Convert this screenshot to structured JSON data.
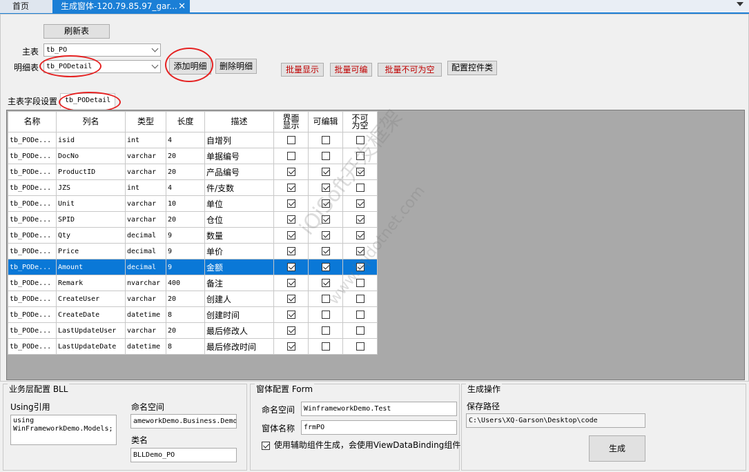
{
  "tabs": {
    "home": "首页",
    "active": "生成窗体-120.79.85.97_gar...",
    "close": "✕"
  },
  "toolbar": {
    "refresh": "刷新表",
    "main_table_label": "主表",
    "main_table_value": "tb_PO",
    "detail_table_label": "明细表",
    "detail_table_value": "tb_PODetail",
    "add_detail": "添加明细",
    "delete_detail": "删除明细",
    "batch_show": "批量显示",
    "batch_edit": "批量可编",
    "batch_required": "批量不可为空",
    "config_control": "配置控件类"
  },
  "subtabs": {
    "main": "主表字段设置",
    "detail": "tb_PODetail"
  },
  "grid": {
    "headers": {
      "name": "名称",
      "column": "列名",
      "type": "类型",
      "length": "长度",
      "desc": "描述",
      "show": "界面\n显示",
      "editable": "可编辑",
      "required": "不可\n为空"
    },
    "rows": [
      {
        "name": "tb_PODe...",
        "column": "isid",
        "type": "int",
        "length": "4",
        "desc": "自增列",
        "show": false,
        "edit": false,
        "req": false
      },
      {
        "name": "tb_PODe...",
        "column": "DocNo",
        "type": "varchar",
        "length": "20",
        "desc": "单据编号",
        "show": false,
        "edit": false,
        "req": false
      },
      {
        "name": "tb_PODe...",
        "column": "ProductID",
        "type": "varchar",
        "length": "20",
        "desc": "产品编号",
        "show": true,
        "edit": true,
        "req": true
      },
      {
        "name": "tb_PODe...",
        "column": "JZS",
        "type": "int",
        "length": "4",
        "desc": "件/支数",
        "show": true,
        "edit": true,
        "req": false
      },
      {
        "name": "tb_PODe...",
        "column": "Unit",
        "type": "varchar",
        "length": "10",
        "desc": "单位",
        "show": true,
        "edit": true,
        "req": true
      },
      {
        "name": "tb_PODe...",
        "column": "SPID",
        "type": "varchar",
        "length": "20",
        "desc": "仓位",
        "show": true,
        "edit": true,
        "req": true
      },
      {
        "name": "tb_PODe...",
        "column": "Qty",
        "type": "decimal",
        "length": "9",
        "desc": "数量",
        "show": true,
        "edit": true,
        "req": true
      },
      {
        "name": "tb_PODe...",
        "column": "Price",
        "type": "decimal",
        "length": "9",
        "desc": "单价",
        "show": true,
        "edit": true,
        "req": true
      },
      {
        "name": "tb_PODe...",
        "column": "Amount",
        "type": "decimal",
        "length": "9",
        "desc": "金额",
        "show": true,
        "edit": true,
        "req": true,
        "selected": true
      },
      {
        "name": "tb_PODe...",
        "column": "Remark",
        "type": "nvarchar",
        "length": "400",
        "desc": "备注",
        "show": true,
        "edit": true,
        "req": false
      },
      {
        "name": "tb_PODe...",
        "column": "CreateUser",
        "type": "varchar",
        "length": "20",
        "desc": "创建人",
        "show": true,
        "edit": false,
        "req": false
      },
      {
        "name": "tb_PODe...",
        "column": "CreateDate",
        "type": "datetime",
        "length": "8",
        "desc": "创建时间",
        "show": true,
        "edit": false,
        "req": false
      },
      {
        "name": "tb_PODe...",
        "column": "LastUpdateUser",
        "type": "varchar",
        "length": "20",
        "desc": "最后修改人",
        "show": true,
        "edit": false,
        "req": false
      },
      {
        "name": "tb_PODe...",
        "column": "LastUpdateDate",
        "type": "datetime",
        "length": "8",
        "desc": "最后修改时间",
        "show": true,
        "edit": false,
        "req": false
      }
    ]
  },
  "watermark": {
    "line1": "iQiSoft开发框架",
    "line2": "www.iqidotnet.com"
  },
  "bll": {
    "title": "业务层配置 BLL",
    "using_label": "Using引用",
    "using_value": "using\nWinFrameworkDemo.Models;",
    "namespace_label": "命名空间",
    "namespace_value": "ameworkDemo.Business.Demo",
    "class_label": "类名",
    "class_value": "BLLDemo_PO"
  },
  "form": {
    "title": "窗体配置 Form",
    "namespace_label": "命名空间",
    "namespace_value": "WinframeworkDemo.Test",
    "name_label": "窗体名称",
    "name_value": "frmPO",
    "helper_label": "使用辅助组件生成，会使用ViewDataBinding组件",
    "helper_checked": true
  },
  "generate": {
    "title": "生成操作",
    "path_label": "保存路径",
    "path_value": "C:\\Users\\XQ-Garson\\Desktop\\code",
    "button": "生成"
  }
}
